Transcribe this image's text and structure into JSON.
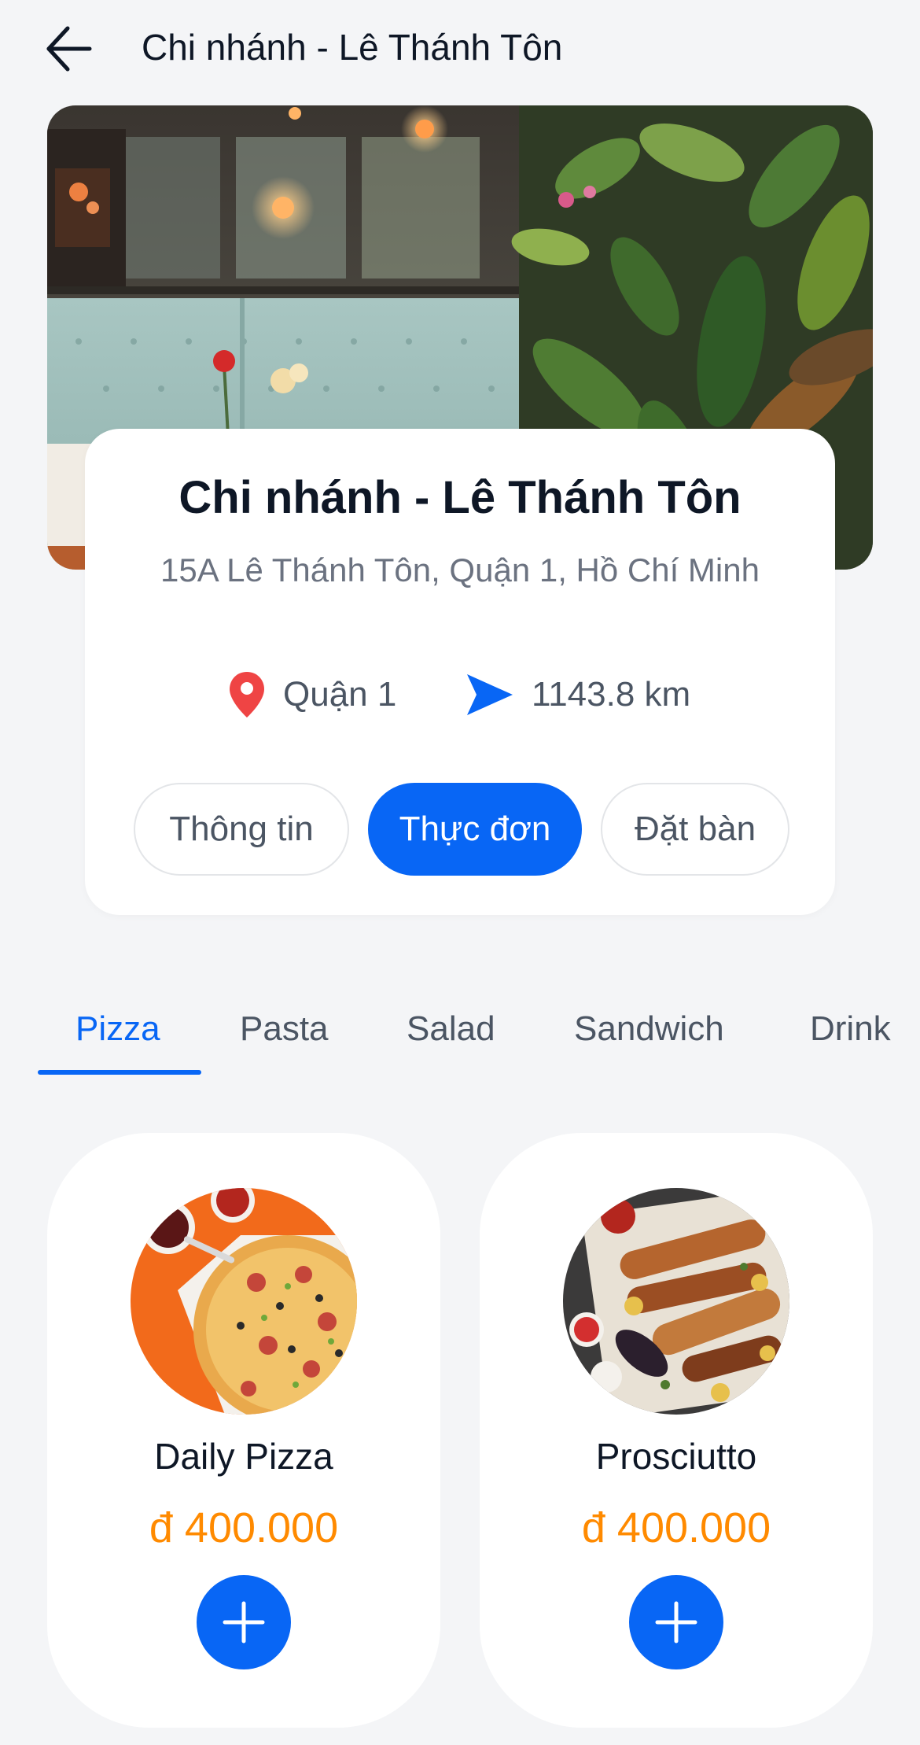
{
  "header": {
    "title": "Chi nhánh - Lê Thánh Tôn",
    "back_icon": "arrow-left-icon"
  },
  "branch": {
    "name": "Chi nhánh - Lê Thánh Tôn",
    "address": "15A Lê Thánh Tôn, Quận 1, Hồ Chí Minh",
    "district": "Quận 1",
    "distance": "1143.8 km",
    "district_icon": "map-pin-icon",
    "distance_icon": "navigation-arrow-icon"
  },
  "tabs": [
    {
      "label": "Thông tin",
      "active": false
    },
    {
      "label": "Thực đơn",
      "active": true
    },
    {
      "label": "Đặt bàn",
      "active": false
    }
  ],
  "categories": [
    {
      "label": "Pizza",
      "active": true
    },
    {
      "label": "Pasta",
      "active": false
    },
    {
      "label": "Salad",
      "active": false
    },
    {
      "label": "Sandwich",
      "active": false
    },
    {
      "label": "Drink",
      "active": false
    }
  ],
  "products": [
    {
      "name": "Daily Pizza",
      "price": "đ 400.000"
    },
    {
      "name": "Prosciutto",
      "price": "đ 400.000"
    }
  ],
  "colors": {
    "accent": "#0866F5",
    "price": "#FF8A00",
    "pin": "#EF4444",
    "background": "#F4F5F7"
  }
}
